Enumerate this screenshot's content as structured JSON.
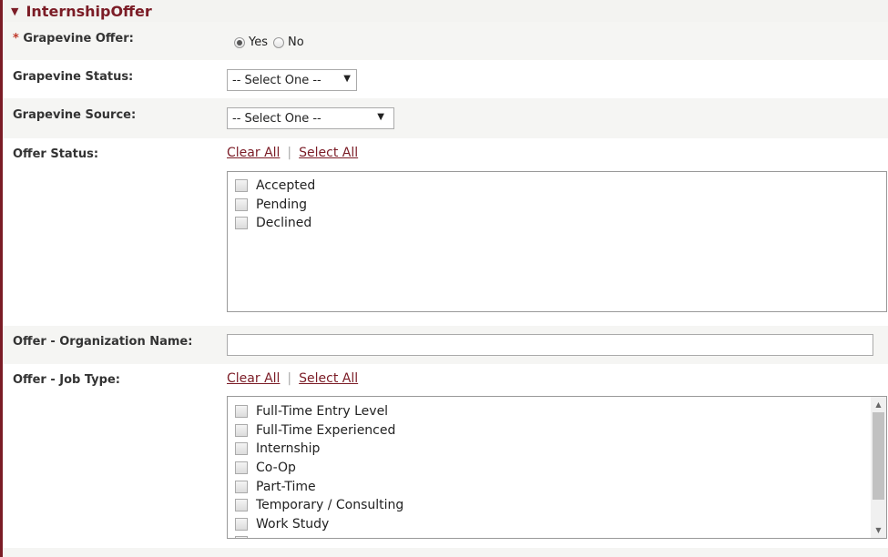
{
  "section": {
    "title": "InternshipOffer"
  },
  "grapevine_offer": {
    "required_mark": "* ",
    "label": "Grapevine Offer:",
    "options": [
      "Yes",
      "No"
    ],
    "selected": "Yes"
  },
  "grapevine_status": {
    "label": "Grapevine Status:",
    "value": "-- Select One --"
  },
  "grapevine_source": {
    "label": "Grapevine Source:",
    "value": "-- Select One --"
  },
  "offer_status": {
    "label": "Offer Status:",
    "clear_all": "Clear All",
    "separator": "|",
    "select_all": "Select All",
    "items": [
      "Accepted",
      "Pending",
      "Declined"
    ]
  },
  "org_name": {
    "label": "Offer - Organization Name:",
    "value": ""
  },
  "job_type": {
    "label": "Offer - Job Type:",
    "clear_all": "Clear All",
    "separator": "|",
    "select_all": "Select All",
    "items": [
      "Full-Time Entry Level",
      "Full-Time Experienced",
      "Internship",
      "Co-Op",
      "Part-Time",
      "Temporary / Consulting",
      "Work Study"
    ]
  },
  "colors": {
    "accent": "#7b1c26",
    "row_shade": "#f5f5f3",
    "required": "#c0392b"
  },
  "icons": {
    "collapse": "triangle-down-icon",
    "dropdown": "chevron-down-icon"
  }
}
